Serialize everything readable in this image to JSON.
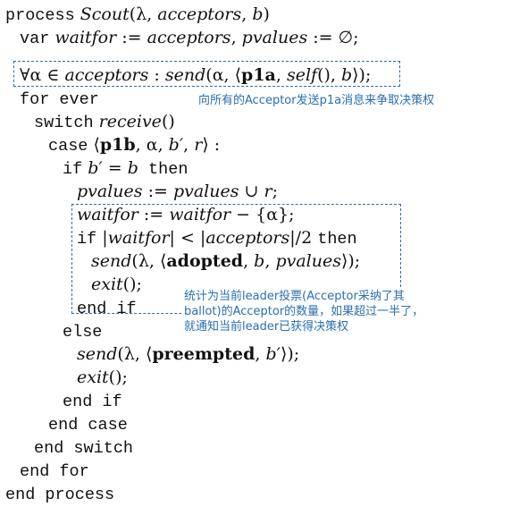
{
  "code": {
    "l1": [
      "process",
      " Scout",
      "(λ, ",
      "acceptors",
      ", ",
      "b",
      ")"
    ],
    "l2": [
      "var",
      " waitfor",
      " := ",
      "acceptors",
      ", ",
      "pvalues",
      " := ∅;"
    ],
    "l3": [
      "∀α ∈ ",
      "acceptors",
      " : ",
      "send",
      "(α, ⟨",
      "p1a",
      ", ",
      "self",
      "(), ",
      "b",
      "⟩);"
    ],
    "l4": [
      "for ever"
    ],
    "l5": [
      "switch",
      " receive",
      "()"
    ],
    "l6": [
      "case",
      " ⟨",
      "p1b",
      ", α, ",
      "b′",
      ", ",
      "r",
      "⟩ :"
    ],
    "l7": [
      "if",
      " b′",
      " = ",
      "b",
      " then"
    ],
    "l8": [
      "pvalues",
      " := ",
      "pvalues",
      " ∪ ",
      "r",
      ";"
    ],
    "l9": [
      "waitfor",
      " := ",
      "waitfor",
      " − {α};"
    ],
    "l10": [
      "if",
      " |",
      "waitfor",
      "| < |",
      "acceptors",
      "|/2 ",
      "then"
    ],
    "l11": [
      "send",
      "(λ, ⟨",
      "adopted",
      ", ",
      "b",
      ", ",
      "pvalues",
      "⟩);"
    ],
    "l12": [
      "exit",
      "();"
    ],
    "l13": [
      "end if"
    ],
    "l14": [
      "else"
    ],
    "l15": [
      "send",
      "(λ, ⟨",
      "preempted",
      ", ",
      "b′",
      "⟩);"
    ],
    "l16": [
      "exit",
      "();"
    ],
    "l17": [
      "end if"
    ],
    "l18": [
      "end case"
    ],
    "l19": [
      "end switch"
    ],
    "l20": [
      "end for"
    ],
    "l21": [
      "end process"
    ]
  },
  "annotations": {
    "note1": "向所有的Acceptor发送p1a消息来争取决策权",
    "note2_line1": "统计为当前leader投票(Acceptor采纳了其",
    "note2_line2": "ballot)的Acceptor的数量，如果超过一半了，",
    "note2_line3": "就通知当前leader已获得决策权"
  },
  "colors": {
    "annotation": "#2a6fb0",
    "text": "#111111",
    "background": "#ffffff"
  }
}
